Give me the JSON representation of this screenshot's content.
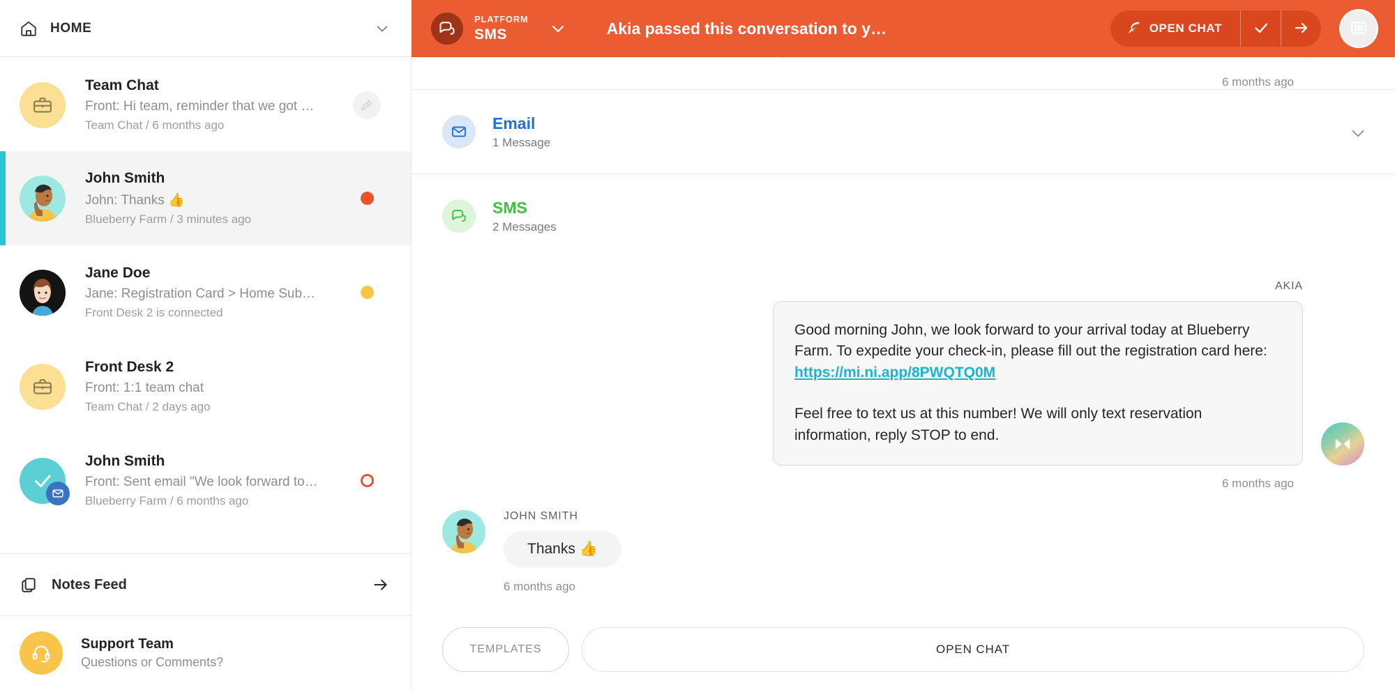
{
  "sidebar": {
    "header": {
      "title": "HOME",
      "home_icon": "home-icon",
      "chevron_icon": "chevron-down-icon"
    },
    "conversations": [
      {
        "name": "Team Chat",
        "preview": "Front: Hi team, reminder that we got …",
        "meta": "Team Chat / 6 months ago",
        "avatar": "briefcase-icon",
        "avatar_color": "#fbdf93",
        "status": "pin",
        "active": false
      },
      {
        "name": "John Smith",
        "preview": "John: Thanks 👍",
        "meta": "Blueberry Farm / 3 minutes ago",
        "avatar": "person-avatar",
        "avatar_color": "#9de8e0",
        "status": "red-dot",
        "status_color": "#f0512b",
        "active": true
      },
      {
        "name": "Jane Doe",
        "preview": "Jane: Registration Card > Home Sub…",
        "meta": "Front Desk 2 is connected",
        "avatar": "woman-avatar",
        "avatar_color": "#111111",
        "status": "yellow-dot",
        "status_color": "#f6c544",
        "active": false
      },
      {
        "name": "Front Desk 2",
        "preview": "Front: 1:1 team chat",
        "meta": "Team Chat / 2 days ago",
        "avatar": "briefcase-icon",
        "avatar_color": "#fbdf93",
        "status": "none",
        "active": false
      },
      {
        "name": "John Smith",
        "preview": "Front: Sent email \"We look forward to…",
        "meta": "Blueberry Farm / 6 months ago",
        "avatar": "check-icon",
        "avatar_color": "#5bcfd4",
        "badge": "mail-icon",
        "status": "red-ring",
        "status_color": "#f0512b",
        "active": false
      }
    ],
    "notes_feed": {
      "label": "Notes Feed",
      "icon": "copy-icon",
      "arrow_icon": "arrow-right-icon"
    },
    "support": {
      "title": "Support Team",
      "subtitle": "Questions or Comments?",
      "icon": "headset-icon",
      "color": "#f8c44a"
    }
  },
  "topbar": {
    "background": "#ec5c33",
    "platform_label": "PLATFORM",
    "platform_value": "SMS",
    "platform_icon": "chat-bubbles-icon",
    "chevron_icon": "chevron-down-icon",
    "title": "Akia passed this conversation to y…",
    "open_chat_label": "OPEN CHAT",
    "open_chat_icon": "feather-icon",
    "resolve_icon": "check-icon",
    "forward_icon": "arrow-right-icon",
    "panel_toggle_icon": "list-panel-icon"
  },
  "thread": {
    "top_timestamp": "6 months ago",
    "channels": [
      {
        "name": "Email",
        "count": "1 Message",
        "icon": "envelope-icon",
        "color": "#2272d6",
        "bg": "#dbe7f8",
        "collapsible": true,
        "chevron_icon": "chevron-down-icon"
      },
      {
        "name": "SMS",
        "count": "2 Messages",
        "icon": "chat-bubbles-icon",
        "color": "#3fc13f",
        "bg": "#ddf4dd",
        "collapsible": false
      }
    ],
    "outgoing": {
      "sender": "AKIA",
      "paragraph1_before_link": "Good morning John, we look forward to your arrival today at Blueberry Farm. To expedite your check-in, please fill out the registration card here: ",
      "link_text": "https://mi.ni.app/8PWQTQ0M",
      "paragraph2": "Feel free to text us at this number! We will only text reservation information, reply STOP to end.",
      "timestamp": "6 months ago",
      "avatar": "akia-logo-avatar"
    },
    "incoming": {
      "sender": "JOHN SMITH",
      "text": "Thanks 👍",
      "timestamp": "6 months ago",
      "avatar": "person-avatar"
    }
  },
  "composer": {
    "templates_label": "TEMPLATES",
    "open_chat_label": "OPEN CHAT"
  }
}
